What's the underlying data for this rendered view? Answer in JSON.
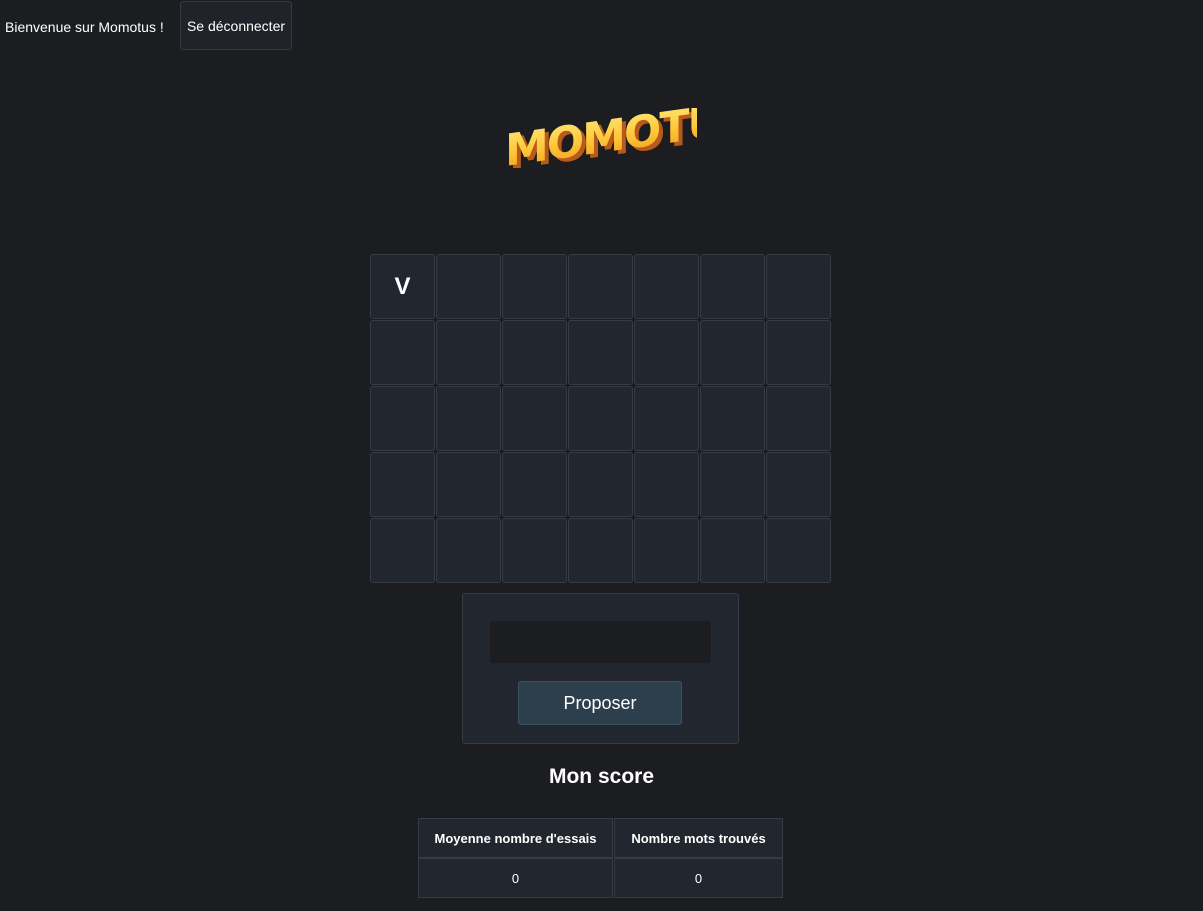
{
  "header": {
    "welcome_text": "Bienvenue sur Momotus !",
    "logout_label": "Se déconnecter"
  },
  "logo": {
    "text": "MOMOTUS",
    "colors": [
      "#ffd54a",
      "#f7a21b",
      "#c9611c"
    ]
  },
  "board": {
    "rows": [
      [
        "V",
        "",
        "",
        "",
        "",
        "",
        ""
      ],
      [
        "",
        "",
        "",
        "",
        "",
        "",
        ""
      ],
      [
        "",
        "",
        "",
        "",
        "",
        "",
        ""
      ],
      [
        "",
        "",
        "",
        "",
        "",
        "",
        ""
      ],
      [
        "",
        "",
        "",
        "",
        "",
        "",
        ""
      ]
    ]
  },
  "guess": {
    "value": "",
    "placeholder": "",
    "submit_label": "Proposer"
  },
  "score": {
    "title": "Mon score",
    "headers": [
      "Moyenne nombre d'essais",
      "Nombre mots trouvés"
    ],
    "values": [
      "0",
      "0"
    ]
  },
  "colors": {
    "background": "#1b1d21",
    "cell": "#22272f",
    "cell_border": "#363b44",
    "button": "#2d3f4d"
  }
}
